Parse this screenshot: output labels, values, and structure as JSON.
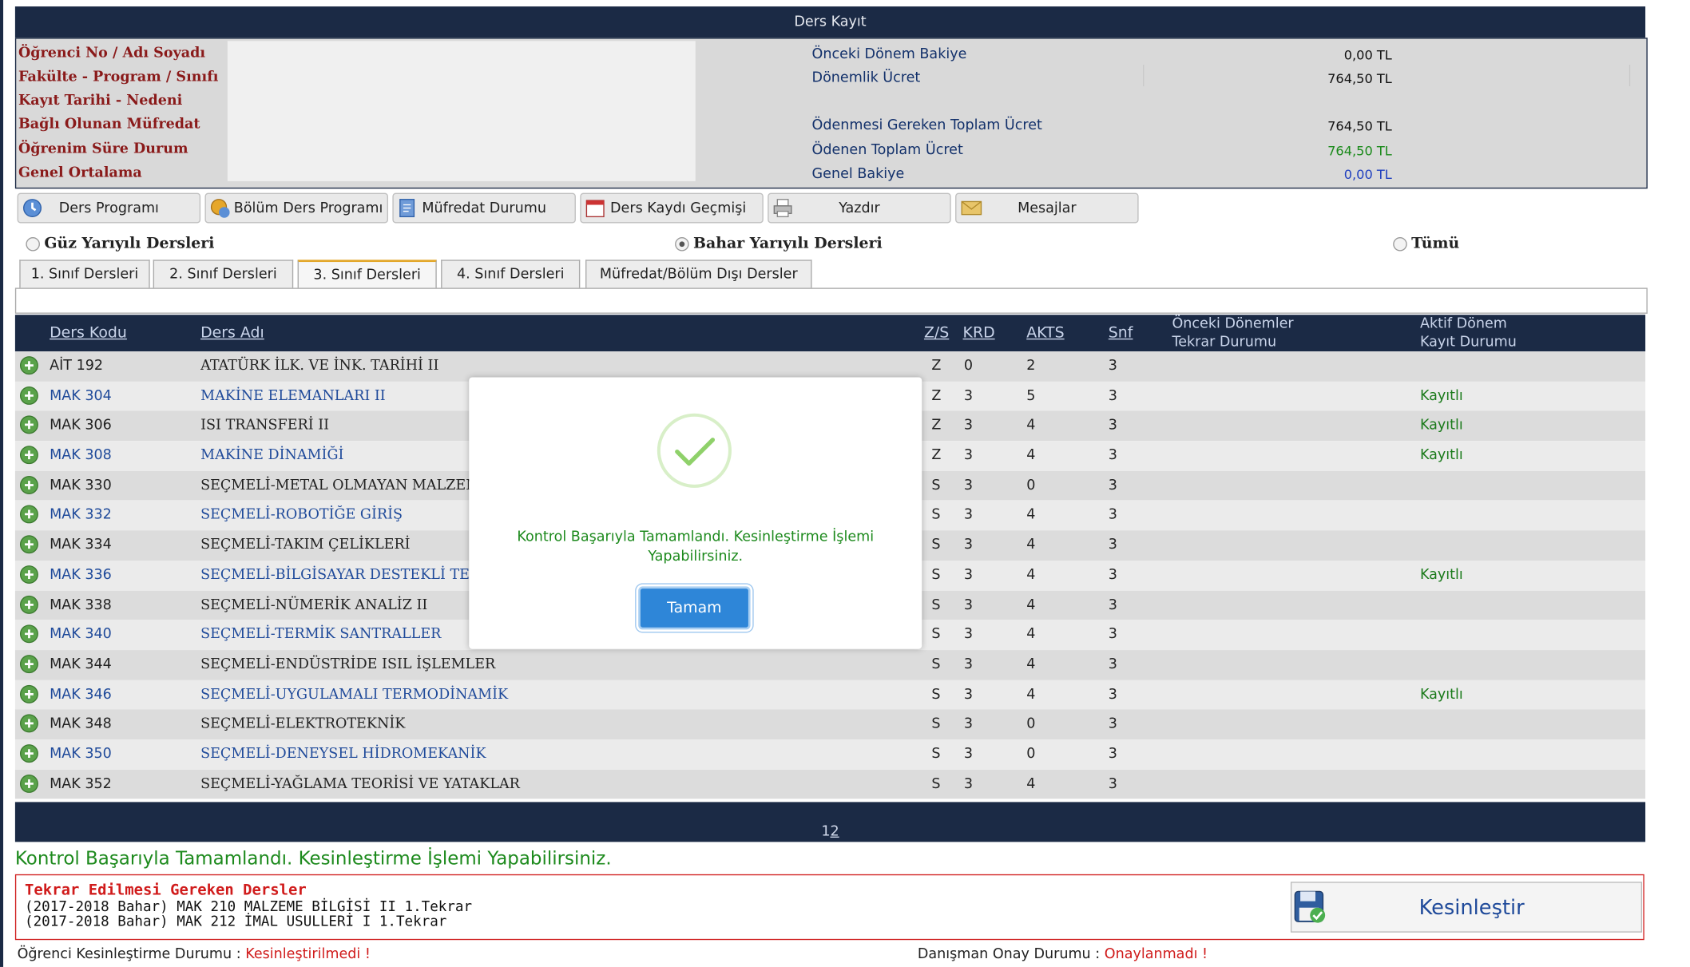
{
  "window": {
    "title": "Ders Kayıt"
  },
  "info": {
    "labels": [
      "Öğrenci No / Adı Soyadı",
      "Fakülte - Program / Sınıfı",
      "Kayıt Tarihi - Nedeni",
      "Bağlı Olunan Müfredat",
      "Öğrenim Süre Durum",
      "Genel Ortalama"
    ],
    "fees": [
      {
        "label": "Önceki Dönem Bakiye",
        "value": "0,00 TL",
        "color": "#111111"
      },
      {
        "label": "Dönemlik Ücret",
        "value": "764,50 TL",
        "color": "#111111"
      },
      {
        "label": "",
        "value": "",
        "color": "#111111"
      },
      {
        "label": "Ödenmesi Gereken Toplam Ücret",
        "value": "764,50 TL",
        "color": "#111111"
      },
      {
        "label": "Ödenen Toplam Ücret",
        "value": "764,50 TL",
        "color": "#1a8a1a"
      },
      {
        "label": "Genel Bakiye",
        "value": "0,00 TL",
        "color": "#1f3fbf"
      }
    ]
  },
  "toolbar": {
    "ders_programi": "Ders Programı",
    "bolum_ders_programi": "Bölüm Ders Programı",
    "mufredat_durumu": "Müfredat Durumu",
    "ders_kaydi_gecmisi": "Ders Kaydı Geçmişi",
    "yazdir": "Yazdır",
    "mesajlar": "Mesajlar"
  },
  "semester": {
    "guz": "Güz Yarıyılı Dersleri",
    "bahar": "Bahar Yarıyılı Dersleri",
    "tumu": "Tümü",
    "selected": "bahar"
  },
  "tabs": [
    "1. Sınıf Dersleri",
    "2. Sınıf Dersleri",
    "3. Sınıf Dersleri",
    "4. Sınıf Dersleri",
    "Müfredat/Bölüm Dışı Dersler"
  ],
  "active_tab": 2,
  "table": {
    "headers": {
      "code": "Ders Kodu",
      "name": "Ders Adı",
      "zs": "Z/S",
      "krd": "KRD",
      "akts": "AKTS",
      "snf": "Snf",
      "prev_line1": "Önceki Dönemler",
      "prev_line2": "Tekrar Durumu",
      "active_line1": "Aktif Dönem",
      "active_line2": "Kayıt Durumu"
    },
    "rows": [
      {
        "code": "AİT 192",
        "name": "ATATÜRK İLK. VE İNK. TARİHİ II",
        "zs": "Z",
        "krd": "0",
        "akts": "2",
        "snf": "3",
        "status": "",
        "link": false
      },
      {
        "code": "MAK 304",
        "name": "MAKİNE ELEMANLARI II",
        "zs": "Z",
        "krd": "3",
        "akts": "5",
        "snf": "3",
        "status": "Kayıtlı",
        "link": true
      },
      {
        "code": "MAK 306",
        "name": "ISI TRANSFERİ II",
        "zs": "Z",
        "krd": "3",
        "akts": "4",
        "snf": "3",
        "status": "Kayıtlı",
        "link": false
      },
      {
        "code": "MAK 308",
        "name": "MAKİNE DİNAMİĞİ",
        "zs": "Z",
        "krd": "3",
        "akts": "4",
        "snf": "3",
        "status": "Kayıtlı",
        "link": true
      },
      {
        "code": "MAK 330",
        "name": "SEÇMELİ-METAL OLMAYAN MALZEM",
        "zs": "S",
        "krd": "3",
        "akts": "0",
        "snf": "3",
        "status": "",
        "link": false
      },
      {
        "code": "MAK 332",
        "name": "SEÇMELİ-ROBOTİĞE GİRİŞ",
        "zs": "S",
        "krd": "3",
        "akts": "4",
        "snf": "3",
        "status": "",
        "link": true
      },
      {
        "code": "MAK 334",
        "name": "SEÇMELİ-TAKIM ÇELİKLERİ",
        "zs": "S",
        "krd": "3",
        "akts": "4",
        "snf": "3",
        "status": "",
        "link": false
      },
      {
        "code": "MAK 336",
        "name": "SEÇMELİ-BİLGİSAYAR DESTEKLİ TE",
        "zs": "S",
        "krd": "3",
        "akts": "4",
        "snf": "3",
        "status": "Kayıtlı",
        "link": true
      },
      {
        "code": "MAK 338",
        "name": "SEÇMELİ-NÜMERİK ANALİZ II",
        "zs": "S",
        "krd": "3",
        "akts": "4",
        "snf": "3",
        "status": "",
        "link": false
      },
      {
        "code": "MAK 340",
        "name": "SEÇMELİ-TERMİK SANTRALLER",
        "zs": "S",
        "krd": "3",
        "akts": "4",
        "snf": "3",
        "status": "",
        "link": true
      },
      {
        "code": "MAK 344",
        "name": "SEÇMELİ-ENDÜSTRİDE ISIL İŞLEMLER",
        "zs": "S",
        "krd": "3",
        "akts": "4",
        "snf": "3",
        "status": "",
        "link": false
      },
      {
        "code": "MAK 346",
        "name": "SEÇMELİ-UYGULAMALI TERMODİNAMİK",
        "zs": "S",
        "krd": "3",
        "akts": "4",
        "snf": "3",
        "status": "Kayıtlı",
        "link": true
      },
      {
        "code": "MAK 348",
        "name": "SEÇMELİ-ELEKTROTEKNİK",
        "zs": "S",
        "krd": "3",
        "akts": "0",
        "snf": "3",
        "status": "",
        "link": false
      },
      {
        "code": "MAK 350",
        "name": "SEÇMELİ-DENEYSEL HİDROMEKANİK",
        "zs": "S",
        "krd": "3",
        "akts": "0",
        "snf": "3",
        "status": "",
        "link": true
      },
      {
        "code": "MAK 352",
        "name": "SEÇMELİ-YAĞLAMA TEORİSİ VE YATAKLAR",
        "zs": "S",
        "krd": "3",
        "akts": "4",
        "snf": "3",
        "status": "",
        "link": false
      }
    ]
  },
  "pager": {
    "page1": "1",
    "page2": "2"
  },
  "result_message": "Kontrol Başarıyla Tamamlandı. Kesinleştirme İşlemi Yapabilirsiniz.",
  "repeat": {
    "title": "Tekrar Edilmesi Gereken Dersler",
    "lines": [
      "(2017-2018 Bahar) MAK 210 MALZEME BİLGİSİ II 1.Tekrar",
      "(2017-2018 Bahar) MAK 212 İMAL USULLERİ I 1.Tekrar"
    ]
  },
  "finalize_button": "Kesinleştir",
  "status": {
    "student_label": "Öğrenci Kesinleştirme Durumu :",
    "student_value": "Kesinleştirilmedi !",
    "advisor_label": "Danışman Onay Durumu :",
    "advisor_value": "Onaylanmadı !"
  },
  "modal": {
    "message": "Kontrol Başarıyla Tamamlandı. Kesinleştirme İşlemi Yapabilirsiniz.",
    "ok_label": "Tamam"
  },
  "colors": {
    "navy": "#1b2a45",
    "success": "#1d8a1d",
    "danger": "#d01b1b",
    "link": "#1f4a9a",
    "modal_button": "#2e86d8"
  }
}
